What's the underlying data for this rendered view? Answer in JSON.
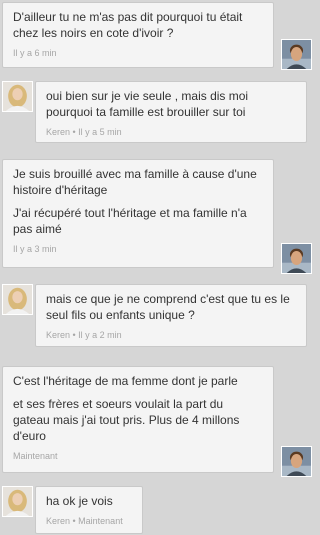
{
  "messages": [
    {
      "sender": "other",
      "lines": [
        "D'ailleur tu ne m'as pas dit pourquoi tu était chez les noirs en cote d'ivoir ?"
      ],
      "meta": "Il y a 6 min"
    },
    {
      "sender": "keren",
      "lines": [
        "oui bien sur je vie seule , mais dis moi pourquoi ta famille est brouiller sur toi"
      ],
      "meta": "Keren • Il y a 5 min"
    },
    {
      "sender": "other",
      "lines": [
        "Je suis brouillé avec ma famille à cause d'une histoire d'héritage",
        "J'ai récupéré tout l'héritage et ma famille n'a pas aimé"
      ],
      "meta": "Il y a 3 min"
    },
    {
      "sender": "keren",
      "lines": [
        "mais ce que je ne comprend c'est que tu es le seul fils ou enfants unique ?"
      ],
      "meta": "Keren • Il y a 2 min"
    },
    {
      "sender": "other",
      "lines": [
        "C'est l'héritage de ma femme dont je parle",
        "et ses frères et soeurs voulait la part du gateau mais j'ai tout pris. Plus de 4 millons d'euro"
      ],
      "meta": "Maintenant"
    },
    {
      "sender": "keren",
      "lines": [
        "ha ok je vois"
      ],
      "meta": "Keren • Maintenant"
    }
  ],
  "colors": {
    "background": "#d6d6d6",
    "bubble": "#f4f4f4",
    "text": "#333333",
    "meta": "#a6a6a6"
  },
  "icons": {
    "other_avatar": "man-portrait-avatar",
    "keren_avatar": "woman-portrait-avatar"
  }
}
